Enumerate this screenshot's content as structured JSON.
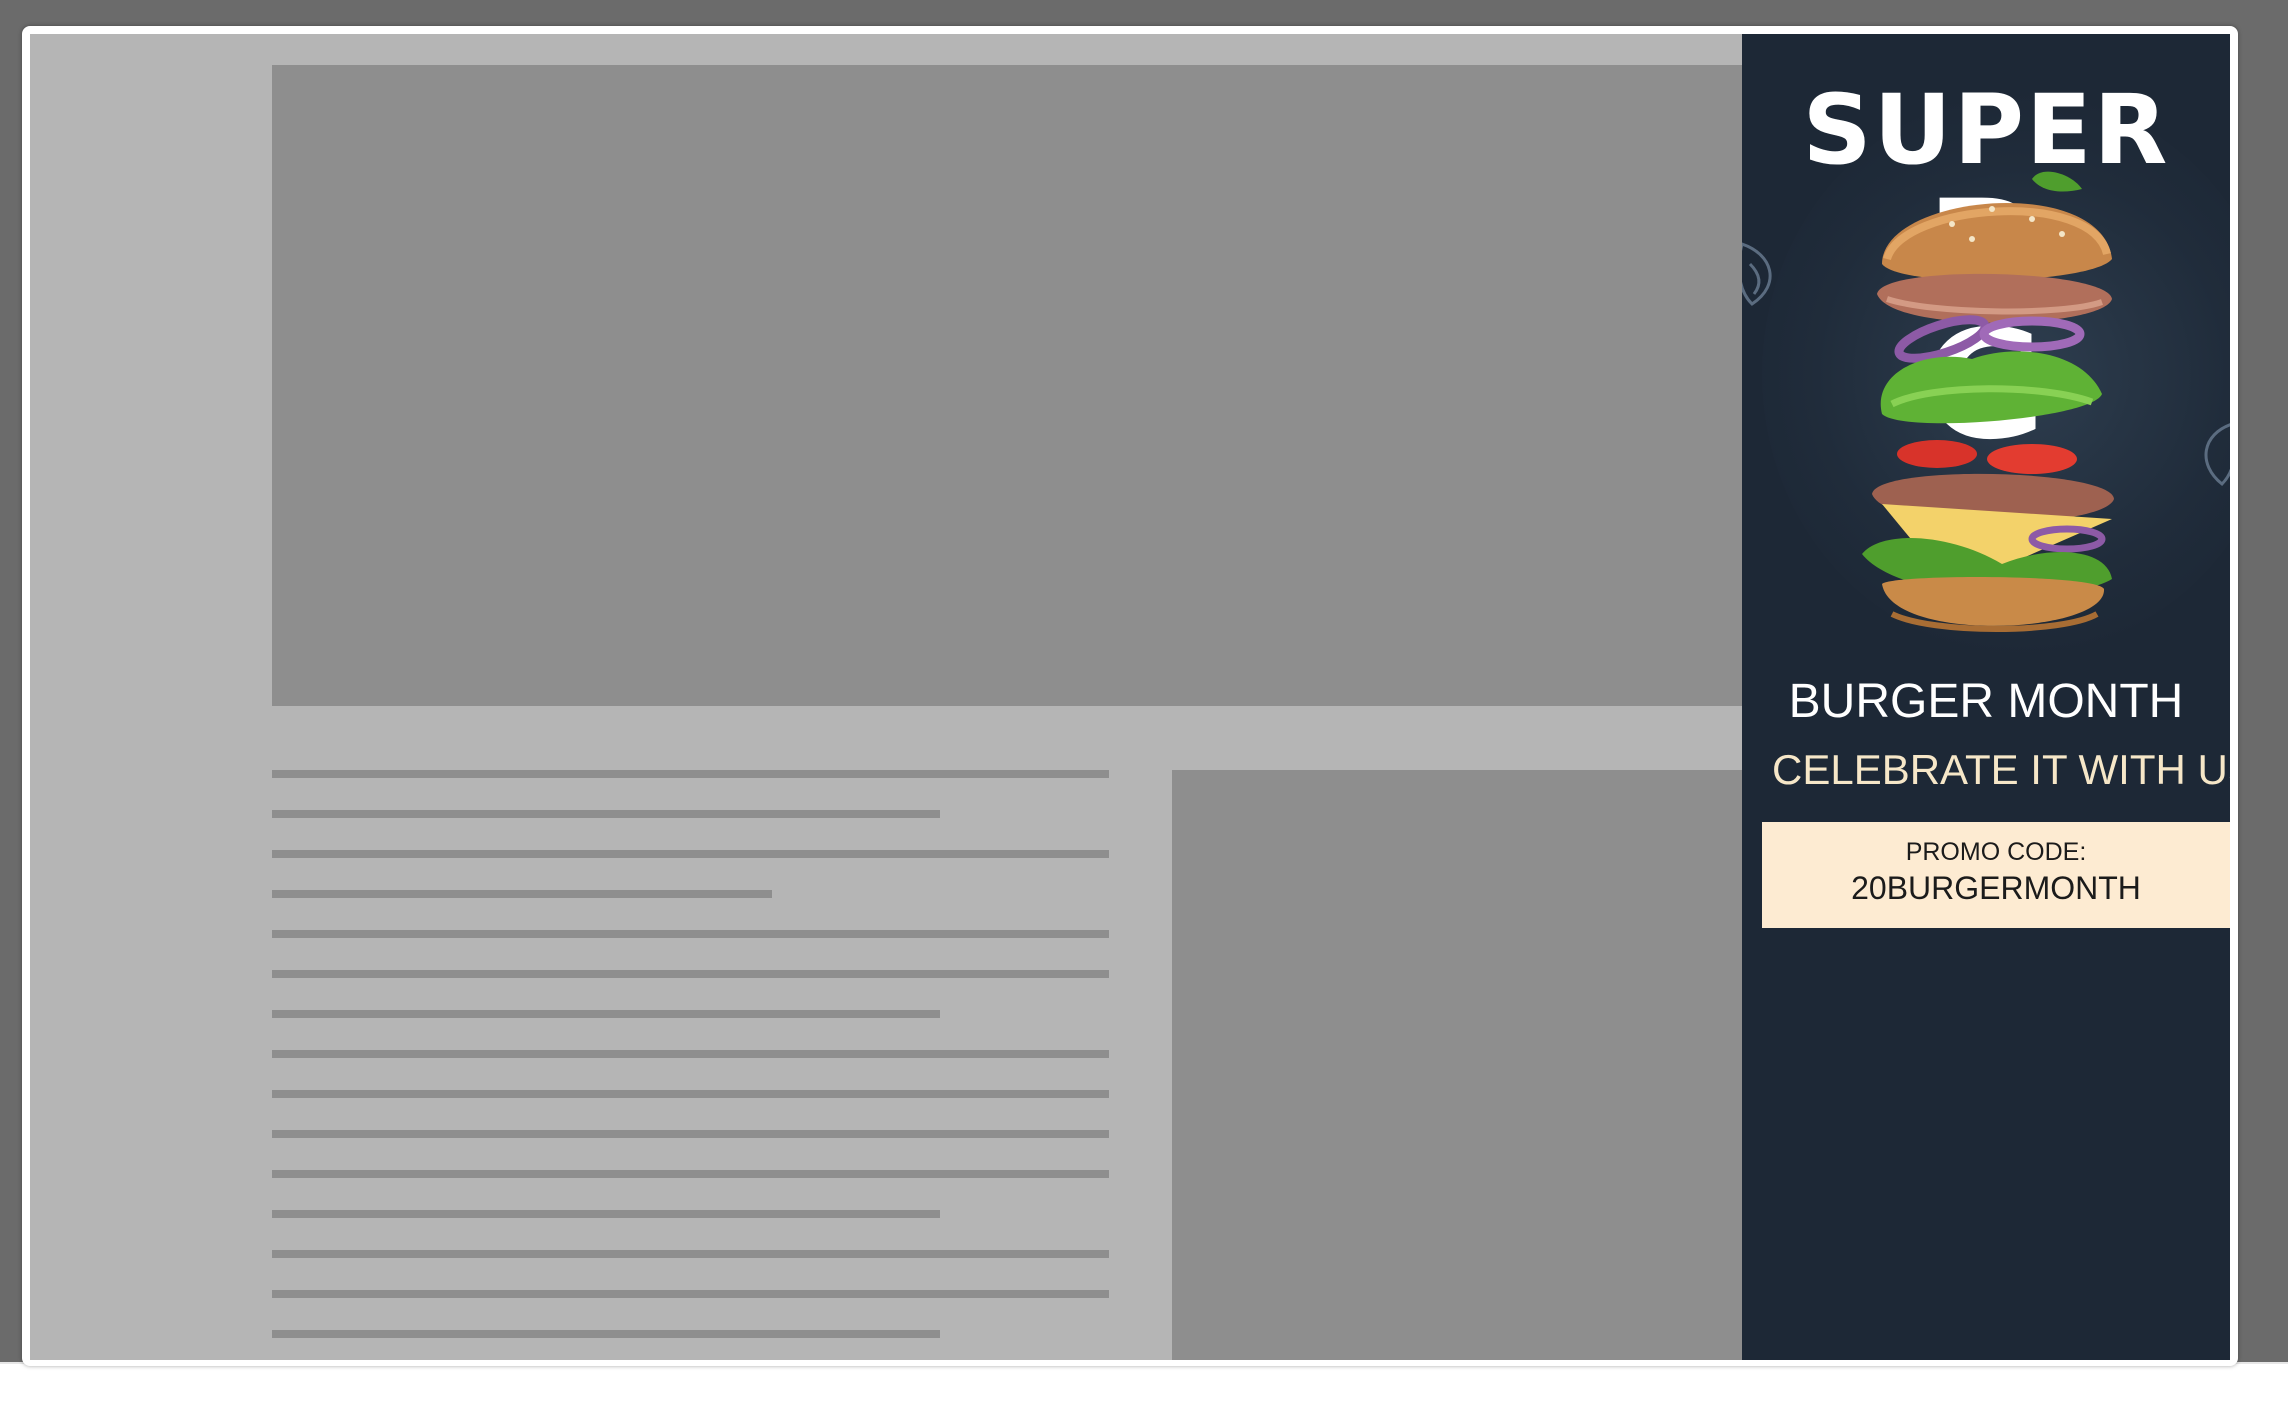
{
  "ad": {
    "title_line1": "SUPER",
    "title_line2": "B",
    "title_line3": "G",
    "heading": "BURGER MONTH",
    "subheading": "CELEBRATE IT WITH US",
    "promo_label": "PROMO CODE:",
    "promo_code": "20BURGERMONTH"
  },
  "colors": {
    "ad_background": "#1d2836",
    "page_background": "#b5b5b5",
    "placeholder": "#8e8e8e",
    "promo_background": "#fdebd2",
    "subheading_text": "#f6e7c8"
  }
}
